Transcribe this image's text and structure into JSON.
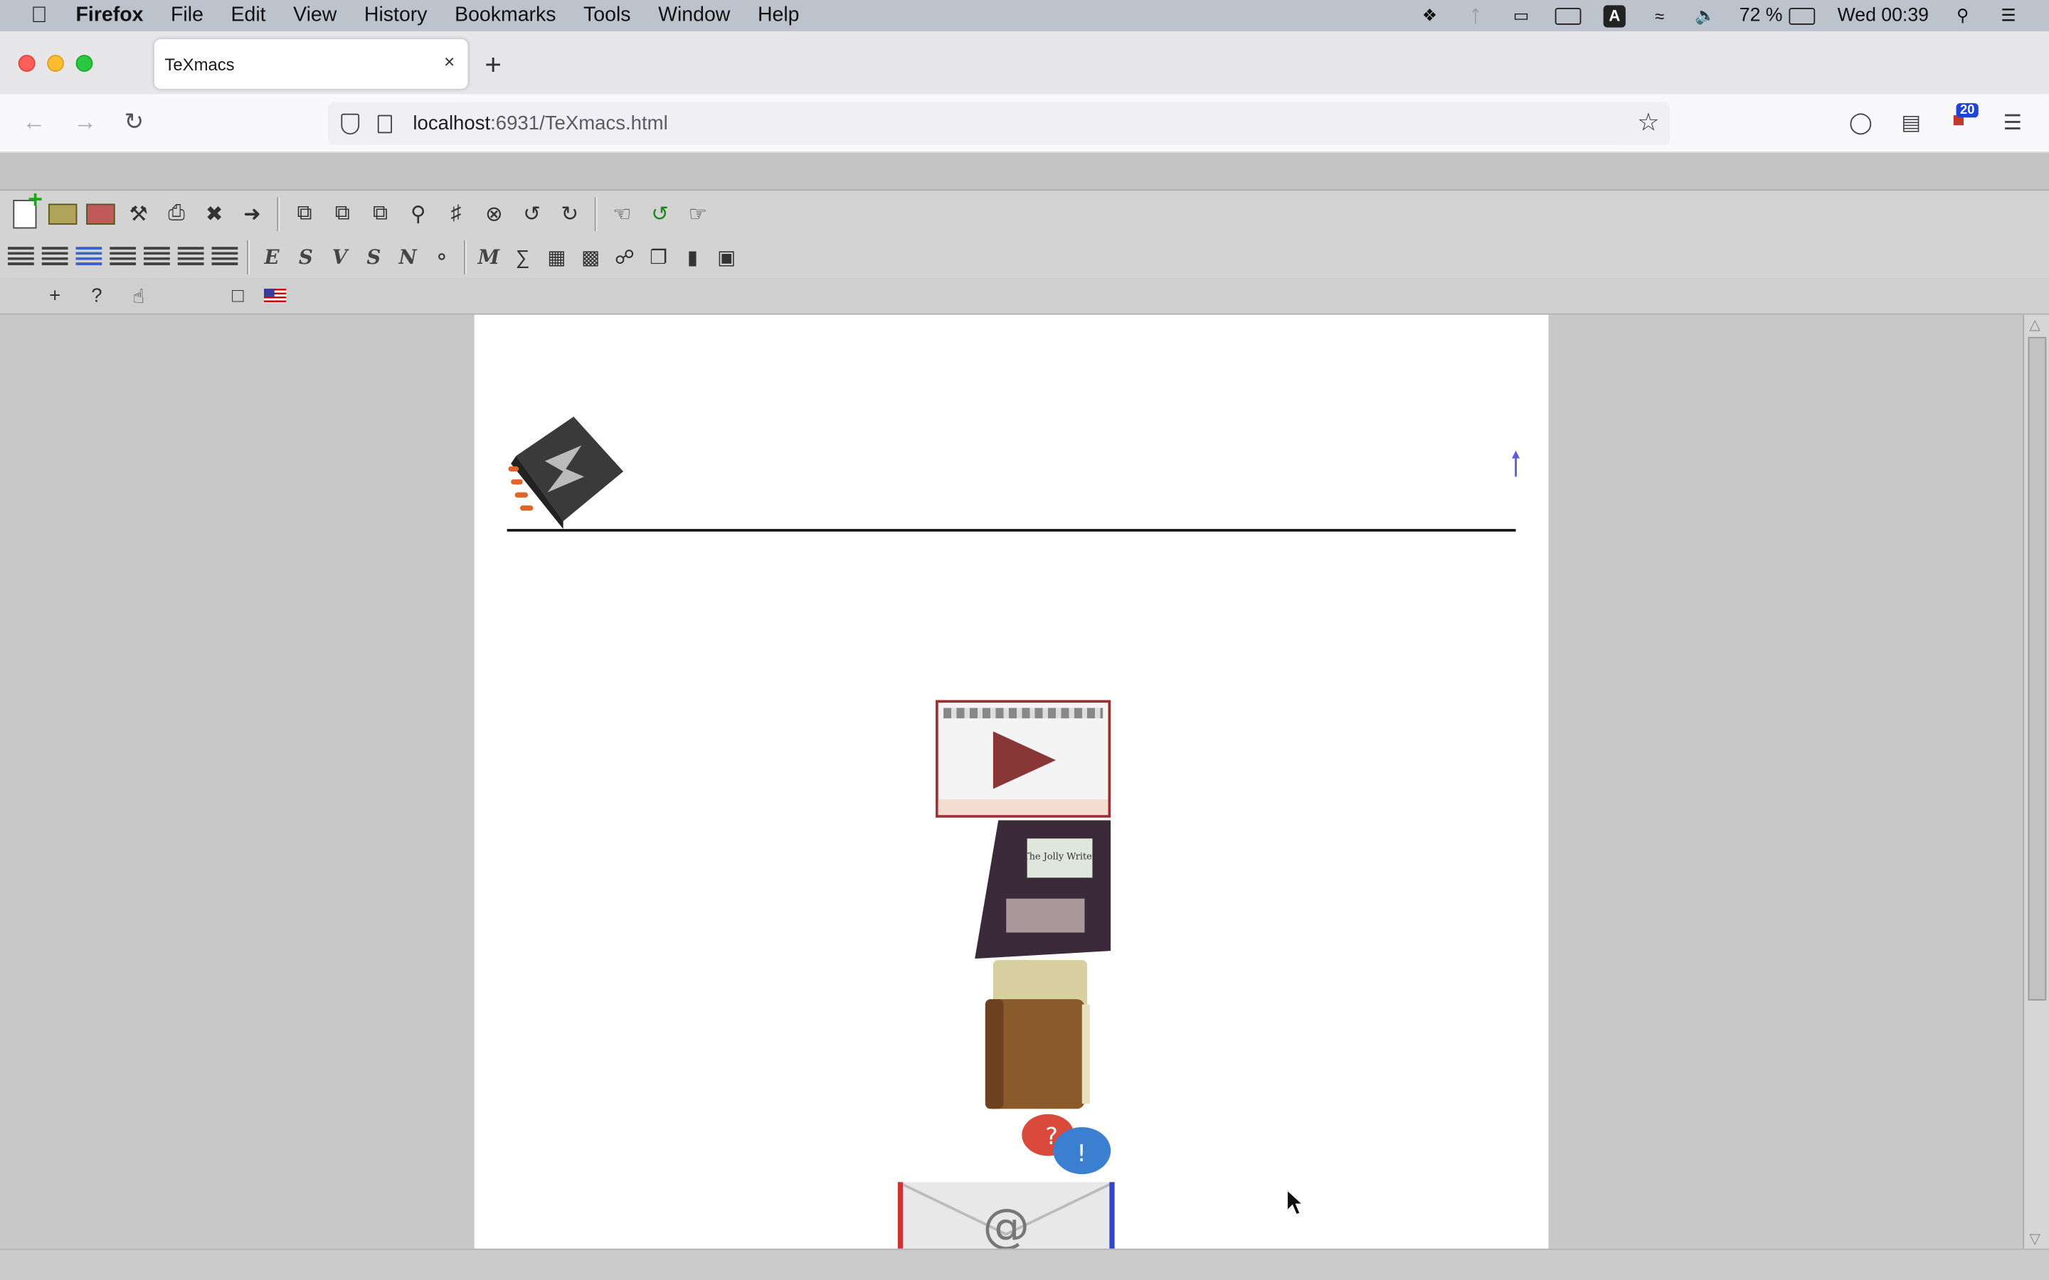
{
  "menubar": {
    "app": "Firefox",
    "items": [
      "File",
      "Edit",
      "View",
      "History",
      "Bookmarks",
      "Tools",
      "Window",
      "Help"
    ],
    "battery": "72 %",
    "clock": "Wed 00:39",
    "icons": [
      "dropbox-icon",
      "bluetooth-icon",
      "airplay-icon",
      "battery-meter-icon",
      "input-source-icon",
      "wifi-icon",
      "volume-icon",
      "battery-icon",
      "spotlight-icon",
      "control-center-icon"
    ],
    "input_source_letter": "A"
  },
  "tab": {
    "title": "TeXmacs",
    "close": "×"
  },
  "newtab": "+",
  "address": {
    "host": "localhost",
    "path": ":6931/TeXmacs.html"
  },
  "toolbar_badge": "20",
  "document": {
    "images": [
      "texmacs-logo",
      "video-thumbnail",
      "jolly-writer-book",
      "books",
      "help-bubbles",
      "mail-envelope"
    ],
    "book_title": "The Jolly Writer",
    "mail_symbol": "@",
    "help_q": "?",
    "help_a": "!"
  },
  "colors": {
    "accent": "#1e44d6",
    "video_border": "#9c3030"
  }
}
